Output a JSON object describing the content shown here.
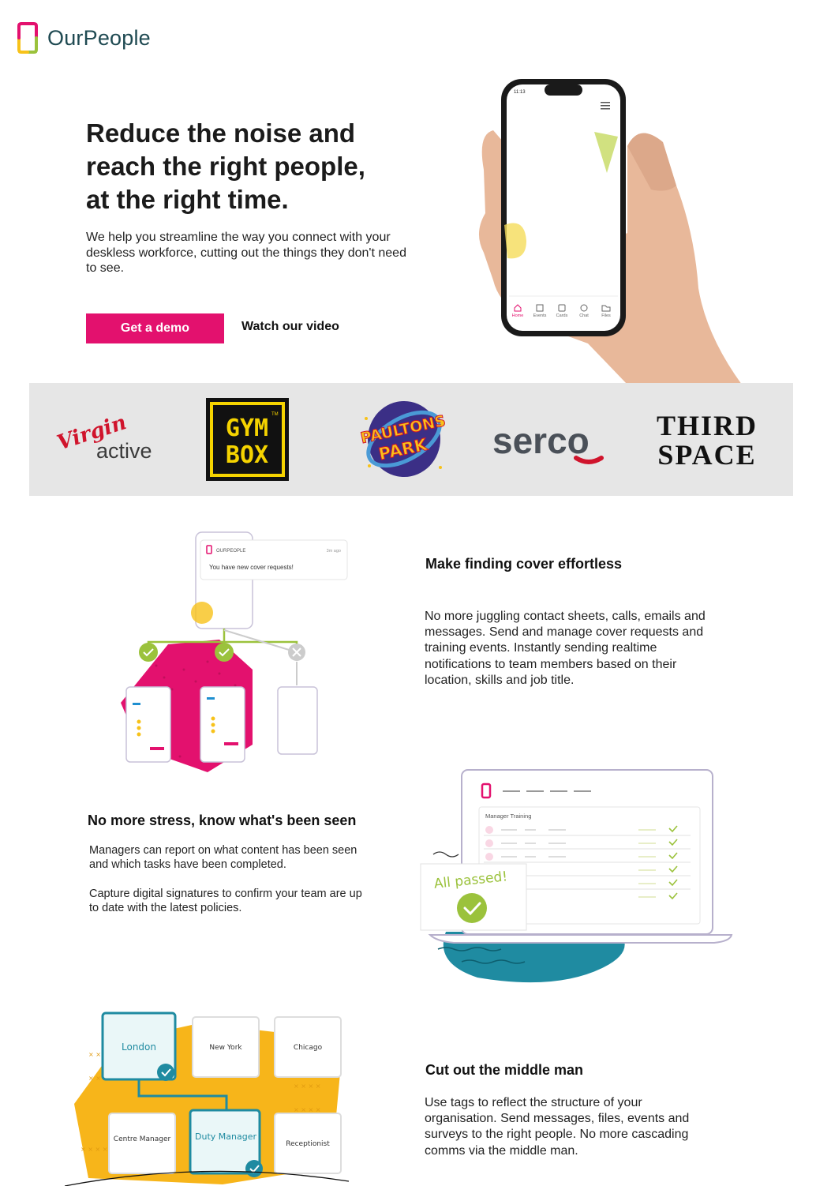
{
  "brand": {
    "name": "OurPeople",
    "accent": "#e3116e",
    "logo_colors": [
      "#e3116e",
      "#f7c21a",
      "#9bc23c",
      "#1f8fd0"
    ]
  },
  "hero": {
    "title_lines": [
      "Reduce the noise and",
      "reach the right people,",
      "at the right time."
    ],
    "subtitle": "We help you streamline the way you connect with your deskless workforce, cutting out the things they don't need to see.",
    "cta_primary": "Get a demo",
    "cta_secondary": "Watch our video",
    "phone": {
      "time": "11:13",
      "nav": [
        "Home",
        "Events",
        "Cards",
        "Chat",
        "Files"
      ]
    }
  },
  "client_logos": [
    {
      "name": "Virgin active",
      "script": "Virgin",
      "word": "active"
    },
    {
      "name": "GYM BOX",
      "line1": "GYM",
      "line2": "BOX",
      "tm": "TM"
    },
    {
      "name": "PAULTONS PARK",
      "line1": "PAULTONS",
      "line2": "PARK"
    },
    {
      "name": "serco",
      "word": "serco"
    },
    {
      "name": "THIRD SPACE",
      "line1": "THIRD",
      "line2": "SPACE"
    }
  ],
  "features": [
    {
      "title": "Make finding cover effortless",
      "body": "No more juggling contact sheets, calls, emails and messages. Send and manage cover requests and training events. Instantly sending realtime notifications to team members based on their location, skills and job title.",
      "illustration": {
        "app_label": "OURPEOPLE",
        "time_ago": "3m ago",
        "notification": "You have new cover requests!"
      }
    },
    {
      "title": "No more stress, know what's been seen",
      "body_1": "Managers can report on what content has been seen and which tasks have been completed.",
      "body_2": "Capture digital signatures to confirm your team are up to date with the latest policies.",
      "illustration": {
        "panel_title": "Manager Training",
        "badge": "All passed!"
      }
    },
    {
      "title": "Cut out the middle man",
      "body": "Use tags to reflect the structure of your organisation. Send messages, files, events and surveys to the right people. No more cascading comms via the middle man.",
      "illustration": {
        "tags_row1": [
          "London",
          "New York",
          "Chicago"
        ],
        "tags_row2": [
          "Centre Manager",
          "Duty Manager",
          "Receptionist"
        ]
      }
    }
  ]
}
